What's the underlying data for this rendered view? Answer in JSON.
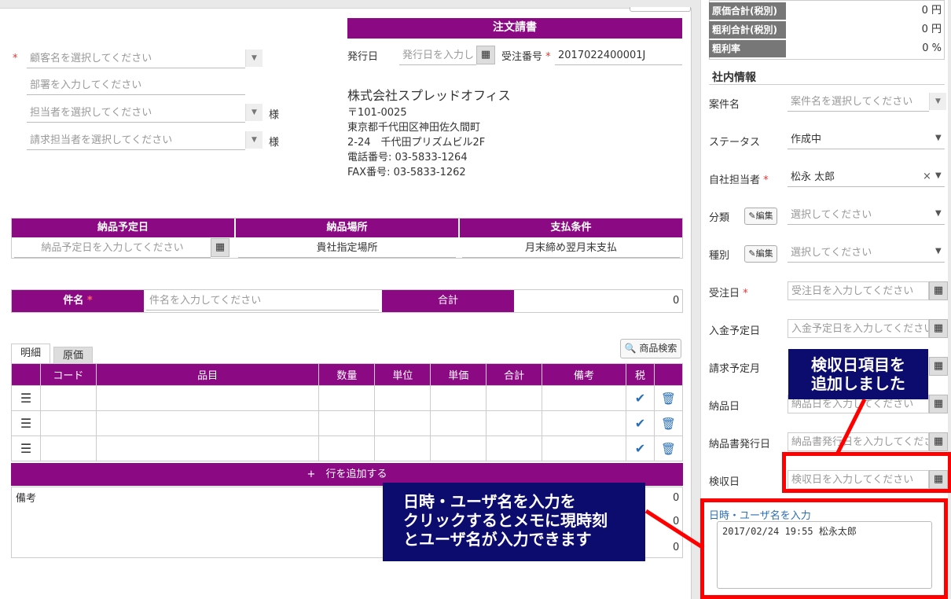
{
  "doc_title": "注文請書",
  "customer": {
    "placeholder": "顧客名を選択してください"
  },
  "department": {
    "placeholder": "部署を入力してください"
  },
  "person": {
    "placeholder": "担当者を選択してください",
    "suffix": "様"
  },
  "billing_person": {
    "placeholder": "請求担当者を選択してください",
    "suffix": "様"
  },
  "issue_date": {
    "label": "発行日",
    "placeholder": "発行日を入力し"
  },
  "order_no": {
    "label": "受注番号",
    "value": "2017022400001J"
  },
  "company": {
    "name": "株式会社スプレッドオフィス",
    "zip": "〒101-0025",
    "address1": "東京都千代田区神田佐久間町",
    "address2": "2-24　千代田プリズムビル2F",
    "tel": "電話番号:  03-5833-1264",
    "fax": "FAX番号:  03-5833-1262"
  },
  "delivery": {
    "date_header": "納品予定日",
    "date_placeholder": "納品予定日を入力してください",
    "place_header": "納品場所",
    "place_value": "貴社指定場所",
    "terms_header": "支払条件",
    "terms_value": "月末締め翌月末支払"
  },
  "subject": {
    "label": "件名",
    "placeholder": "件名を入力してください",
    "total_label": "合計",
    "total_value": "0"
  },
  "tabs": [
    {
      "label": "明細"
    },
    {
      "label": "原価"
    }
  ],
  "product_search": "商品検索",
  "table": {
    "headers": [
      "",
      "コード",
      "品目",
      "数量",
      "単位",
      "単価",
      "合計",
      "備考",
      "税",
      ""
    ],
    "rows": 3
  },
  "add_row": "+　行を追加する",
  "remarks_label": "備考",
  "summary_values": [
    "0",
    "0",
    "0"
  ],
  "cost_summary": [
    {
      "label": "原価合計(税別)",
      "value": "0 円"
    },
    {
      "label": "粗利合計(税別)",
      "value": "0 円"
    },
    {
      "label": "粗利率",
      "value": "0 %"
    }
  ],
  "internal": {
    "heading": "社内情報",
    "project": {
      "label": "案件名",
      "placeholder": "案件名を選択してください"
    },
    "status": {
      "label": "ステータス",
      "value": "作成中"
    },
    "owner": {
      "label": "自社担当者",
      "value": "松永 太郎"
    },
    "category": {
      "label": "分類",
      "edit": "編集",
      "placeholder": "選択してください"
    },
    "kind": {
      "label": "種別",
      "edit": "編集",
      "placeholder": "選択してください"
    },
    "order_date": {
      "label": "受注日",
      "placeholder": "受注日を入力してください"
    },
    "payment_date": {
      "label": "入金予定日",
      "placeholder": "入金予定日を入力してください"
    },
    "billing_month": {
      "label": "請求予定月"
    },
    "delivery_date": {
      "label": "納品日",
      "placeholder": "納品日を入力してください"
    },
    "delivery_doc_date": {
      "label": "納品書発行日",
      "placeholder": "納品書発行日を入力してください"
    },
    "inspection_date": {
      "label": "検収日",
      "placeholder": "検収日を入力してください"
    },
    "memo_link": "日時・ユーザ名を入力",
    "memo_value": "2017/02/24 19:55 松永太郎"
  },
  "callouts": {
    "inspection_line1": "検収日項目を",
    "inspection_line2": "追加しました",
    "memo_line1": "日時・ユーザ名を入力を",
    "memo_line2": "クリックするとメモに現時刻",
    "memo_line3": "とユーザ名が入力できます"
  },
  "colors": {
    "accent": "#8b0a84",
    "callout": "#0c0c6e",
    "highlight": "#ff0000"
  }
}
